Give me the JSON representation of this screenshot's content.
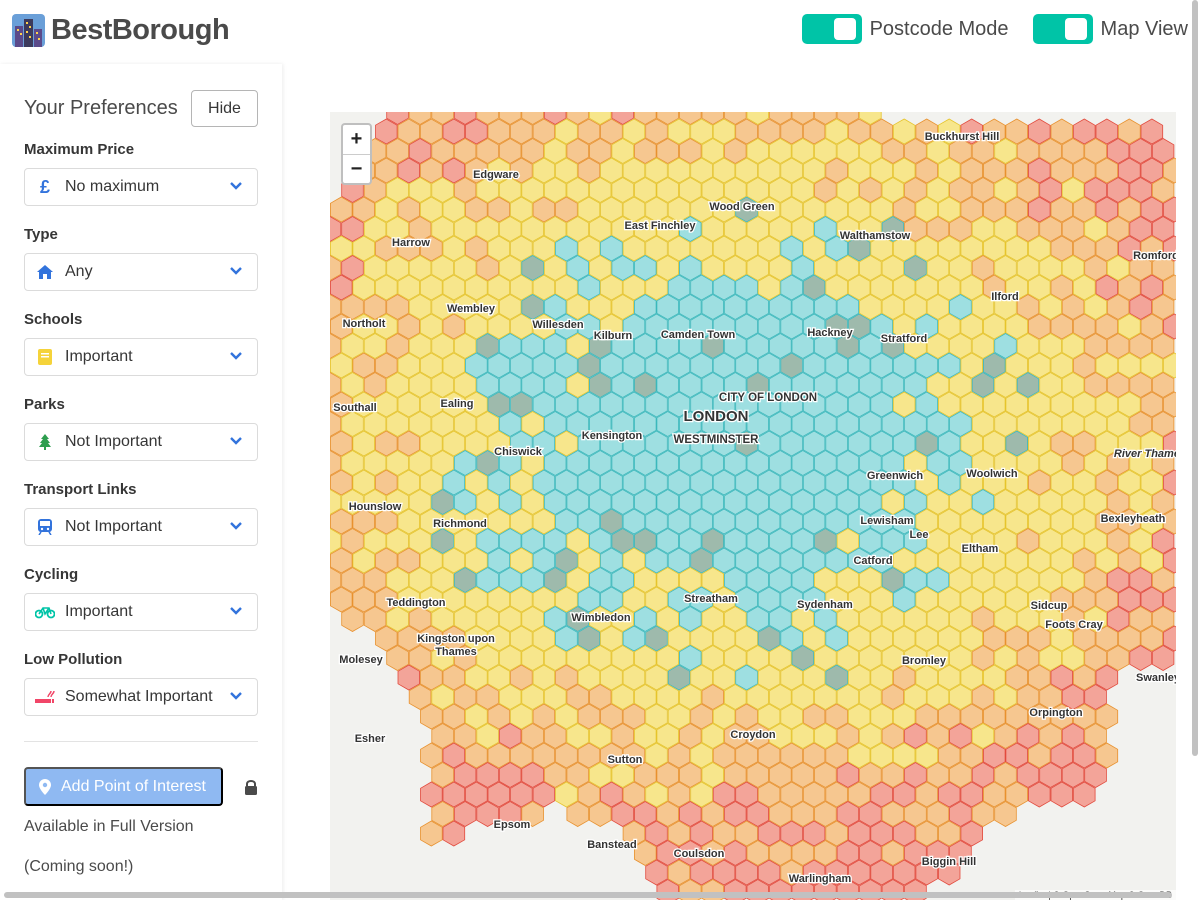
{
  "header": {
    "brand": "BestBorough",
    "toggles": [
      {
        "label": "Postcode Mode",
        "on": true
      },
      {
        "label": "Map View",
        "on": true
      }
    ]
  },
  "sidebar": {
    "title": "Your Preferences",
    "hide_label": "Hide",
    "fields": [
      {
        "label": "Maximum Price",
        "value": "No maximum",
        "icon": "pound-icon"
      },
      {
        "label": "Type",
        "value": "Any",
        "icon": "home-icon"
      },
      {
        "label": "Schools",
        "value": "Important",
        "icon": "book-icon"
      },
      {
        "label": "Parks",
        "value": "Not Important",
        "icon": "tree-icon"
      },
      {
        "label": "Transport Links",
        "value": "Not Important",
        "icon": "train-icon"
      },
      {
        "label": "Cycling",
        "value": "Important",
        "icon": "bicycle-icon"
      },
      {
        "label": "Low Pollution",
        "value": "Somewhat Important",
        "icon": "smoking-icon"
      }
    ],
    "poi_button": "Add Point of Interest",
    "poi_note": "Available in Full Version (Coming soon!)"
  },
  "map": {
    "zoom_in": "+",
    "zoom_out": "−",
    "places": [
      "Edgware",
      "Buckhurst Hill",
      "Wood Green",
      "East Finchley",
      "Walthamstow",
      "Romford",
      "Harrow",
      "Wembley",
      "Willesden",
      "Kilburn",
      "Camden Town",
      "Hackney",
      "Stratford",
      "Ilford",
      "Northolt",
      "Southall",
      "Ealing",
      "CITY OF LONDON",
      "LONDON",
      "WESTMINSTER",
      "Kensington",
      "Chiswick",
      "Greenwich",
      "Woolwich",
      "River Thames",
      "Hounslow",
      "Richmond",
      "Lewisham",
      "Lee",
      "Eltham",
      "Bexleyheath",
      "Catford",
      "Teddington",
      "Streatham",
      "Sydenham",
      "Sidcup",
      "Foots Cray",
      "Wimbledon",
      "Kingston upon",
      "Thames",
      "Molesey",
      "Bromley",
      "Swanley",
      "Orpington",
      "Esher",
      "Croydon",
      "Sutton",
      "Epsom",
      "Banstead",
      "Coulsdon",
      "Biggin Hill",
      "Warlingham"
    ],
    "attribution": "Leaflet | © OpenStreetMap © CartoDB"
  }
}
